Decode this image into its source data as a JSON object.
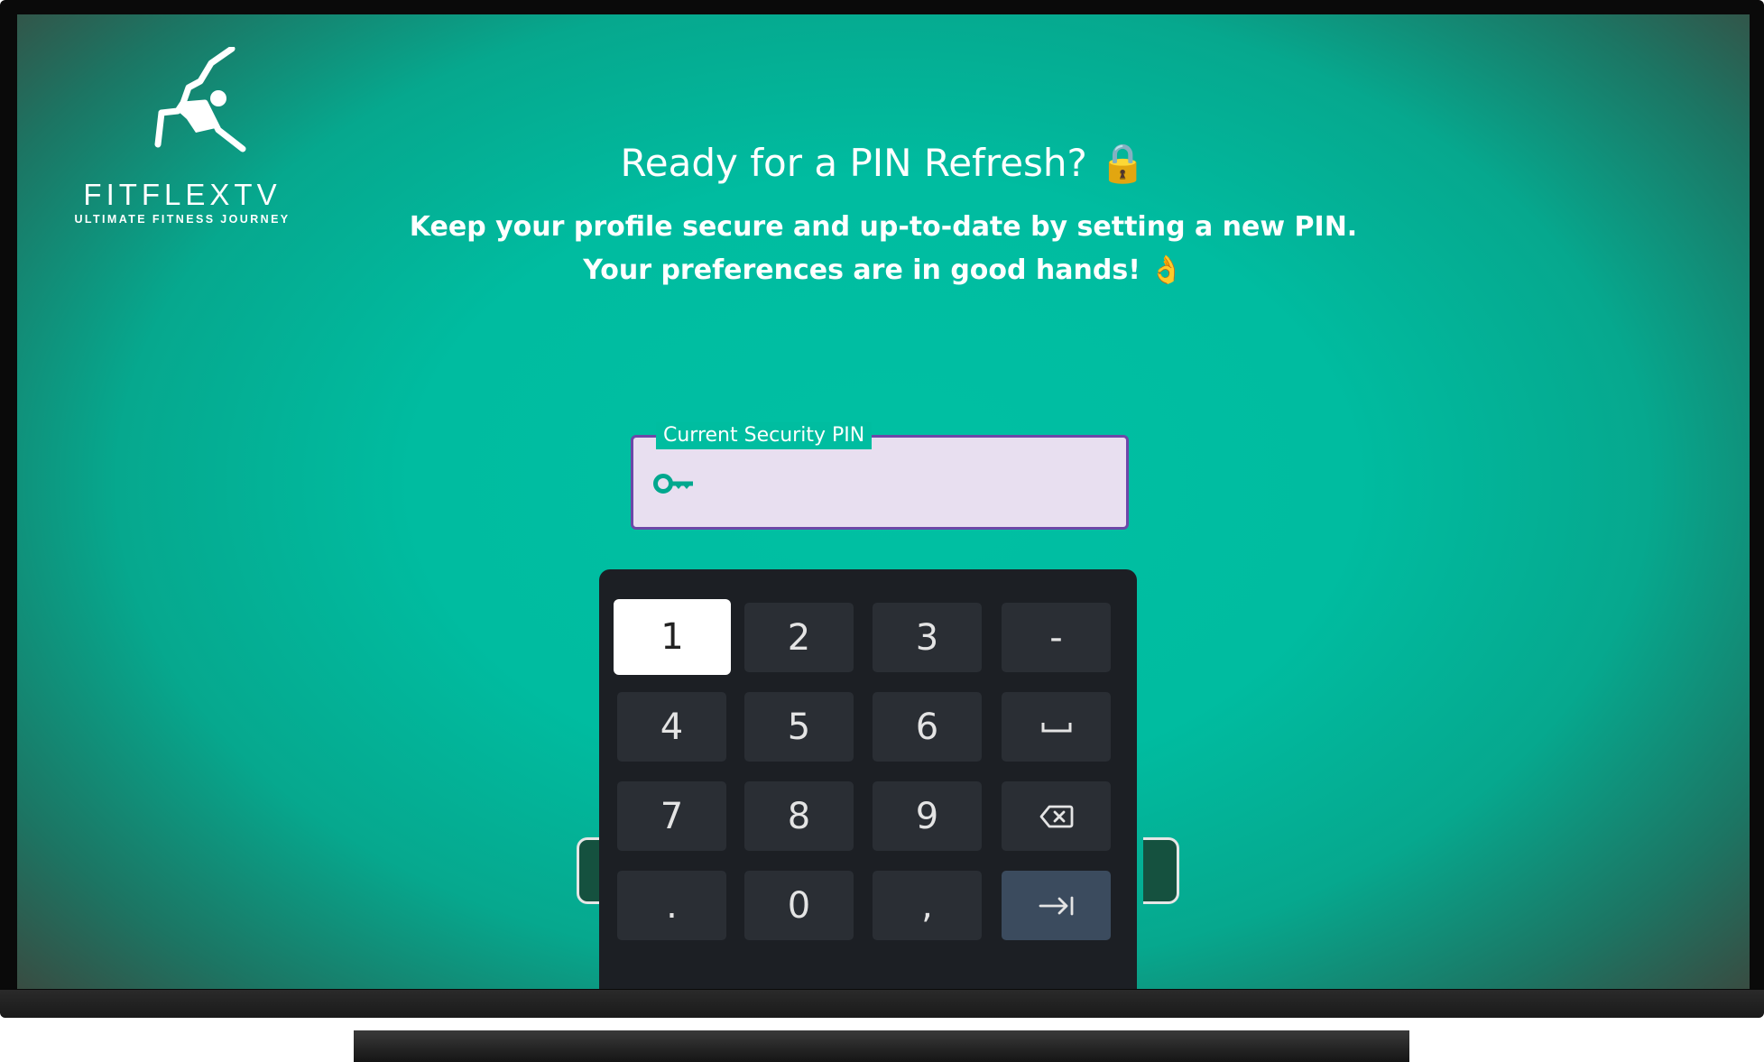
{
  "brand": {
    "name": "FITFLEXTV",
    "tagline": "ULTIMATE FITNESS JOURNEY"
  },
  "header": {
    "title": "Ready for a PIN Refresh? 🔒",
    "subtitle_line1": "Keep your profile secure and up-to-date by setting a new PIN.",
    "subtitle_line2": "Your preferences are in good hands! 👌"
  },
  "pin_field": {
    "label": "Current Security PIN",
    "value": "",
    "icon": "key-icon",
    "focused": true
  },
  "keypad": {
    "focused_key": "1",
    "keys": [
      [
        "1",
        "2",
        "3",
        "-"
      ],
      [
        "4",
        "5",
        "6",
        "space-icon"
      ],
      [
        "7",
        "8",
        "9",
        "backspace-icon"
      ],
      [
        ".",
        "0",
        ",",
        "next-icon"
      ]
    ],
    "labels": {
      "k1": "1",
      "k2": "2",
      "k3": "3",
      "dash": "-",
      "k4": "4",
      "k5": "5",
      "k6": "6",
      "k7": "7",
      "k8": "8",
      "k9": "9",
      "dot": ".",
      "k0": "0",
      "comma": ","
    }
  },
  "colors": {
    "accent": "#00bea3",
    "field_border": "#6d47a8",
    "field_bg": "#e8dff0",
    "keypad_bg": "#1c1f24",
    "key_bg": "#2a2e34",
    "action_key_bg": "#3b4b5e"
  }
}
